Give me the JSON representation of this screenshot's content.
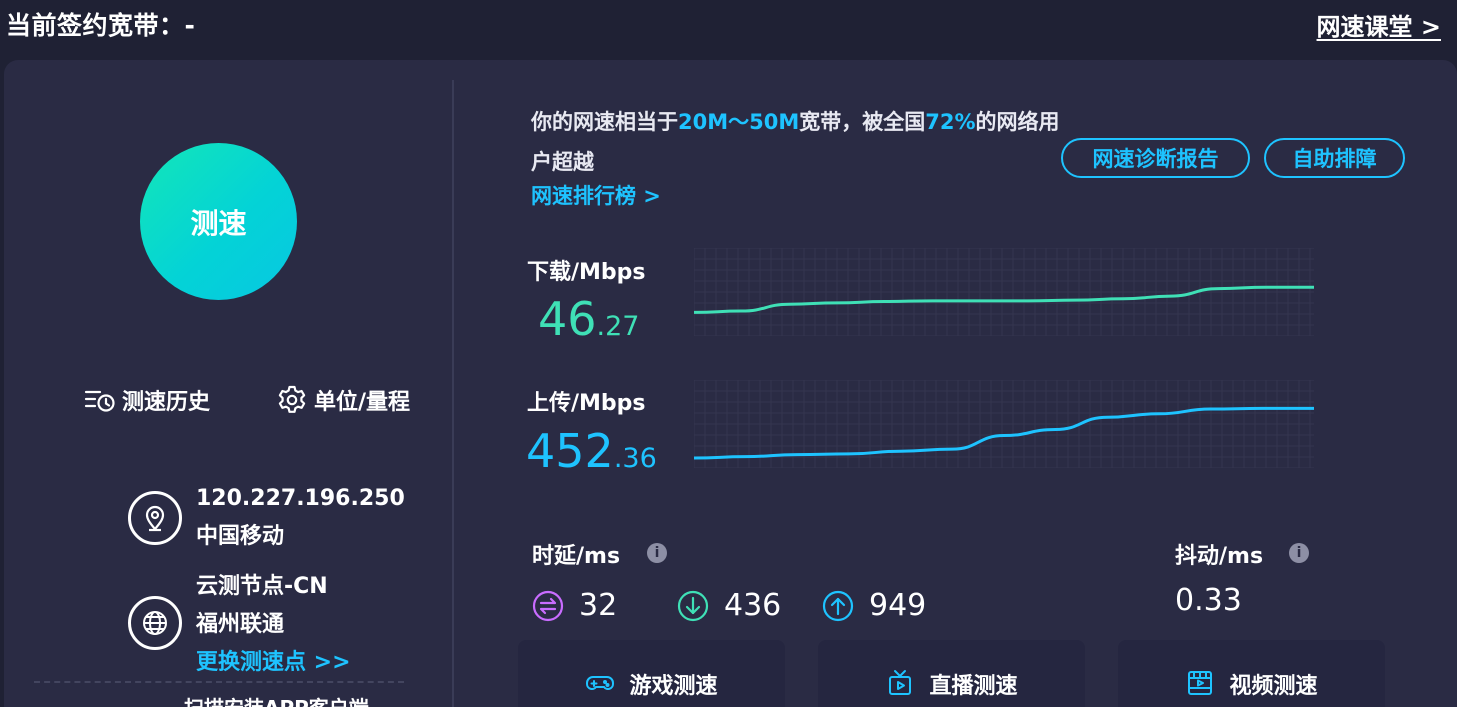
{
  "header": {
    "contract_label": "当前签约宽带：-",
    "class_link": "网速课堂 >"
  },
  "left": {
    "speed_button": "测速",
    "history_label": "测速历史",
    "unit_label": "单位/量程",
    "ip": "120.227.196.250",
    "isp": "中国移动",
    "node_name": "云测节点-CN",
    "node_isp": "福州联通",
    "change_node": "更换测速点 >>",
    "qr_hint": "扫描安装APP客户端"
  },
  "summary": {
    "prefix": "你的网速相当于",
    "range": "20M～50M",
    "middle": "宽带，被全国",
    "percent": "72%",
    "suffix": "的网络用户超越",
    "rank_link": "网速排行榜 >",
    "report_button": "网速诊断报告",
    "self_help_button": "自助排障"
  },
  "download": {
    "label": "下载/Mbps",
    "int": "46",
    "dec": ".27",
    "color": "#3fe0b6",
    "trend": [
      0.2,
      0.22,
      0.32,
      0.34,
      0.36,
      0.37,
      0.37,
      0.37,
      0.38,
      0.4,
      0.44,
      0.55,
      0.57,
      0.57
    ]
  },
  "upload": {
    "label": "上传/Mbps",
    "int": "452",
    "dec": ".36",
    "color": "#1ec3ff",
    "trend": [
      0.0,
      0.02,
      0.05,
      0.06,
      0.1,
      0.13,
      0.33,
      0.42,
      0.6,
      0.65,
      0.72,
      0.73,
      0.73
    ]
  },
  "latency": {
    "label": "时延/ms",
    "idle": "32",
    "down": "436",
    "up": "949",
    "idle_color": "#c96cff",
    "down_color": "#3fe0b6",
    "up_color": "#1ec3ff"
  },
  "jitter": {
    "label": "抖动/ms",
    "value": "0.33"
  },
  "info_icon_text": "i",
  "modes": [
    {
      "label": "游戏测速",
      "icon": "gamepad-icon"
    },
    {
      "label": "直播测速",
      "icon": "tv-icon"
    },
    {
      "label": "视频测速",
      "icon": "film-icon"
    }
  ]
}
